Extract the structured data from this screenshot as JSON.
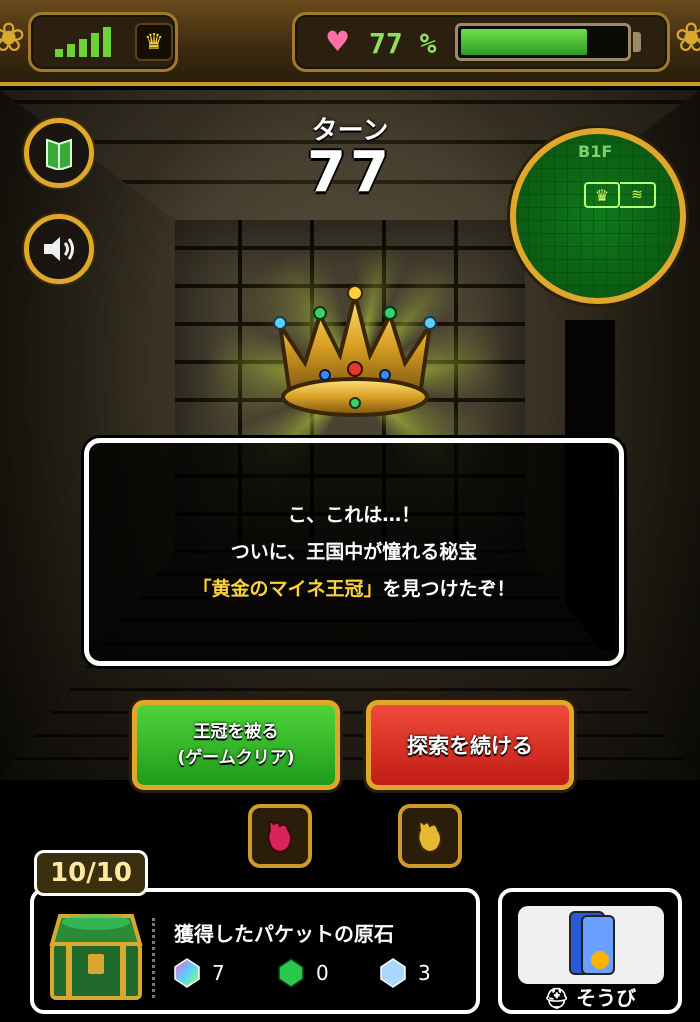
{
  "status_bar": {
    "signal_level": 5,
    "crown_icon": "crown-icon",
    "battery_percent_text": "77 %",
    "battery_level": 0.77,
    "colors": {
      "accent_gold": "#e0a82a",
      "battery_green": "#6ee04a",
      "heart": "#ff6fa8"
    }
  },
  "turn": {
    "label": "ターン",
    "value": "77"
  },
  "minimap": {
    "floor": "B1F"
  },
  "side_buttons": [
    {
      "name": "guide-book",
      "icon": "book-icon"
    },
    {
      "name": "sound",
      "icon": "speaker-icon"
    }
  ],
  "dialog": {
    "line1": "こ、これは…！",
    "line2": "ついに、王国中が憧れる秘宝",
    "line3_highlight": "「黄金のマイネ王冠」",
    "line3_rest": "を見つけたぞ！"
  },
  "actions": {
    "wear_crown_line1": "王冠を被る",
    "wear_crown_line2": "(ゲームクリア)",
    "continue_label": "探索を続ける"
  },
  "inventory": {
    "capacity": "10/10",
    "stones_title": "獲得したパケットの原石",
    "stones": [
      {
        "icon": "rainbow-gem-icon",
        "count": "7"
      },
      {
        "icon": "green-gem-icon",
        "count": "0"
      },
      {
        "icon": "blue-gem-icon",
        "count": "3"
      }
    ]
  },
  "equipment": {
    "label": "そうび"
  }
}
